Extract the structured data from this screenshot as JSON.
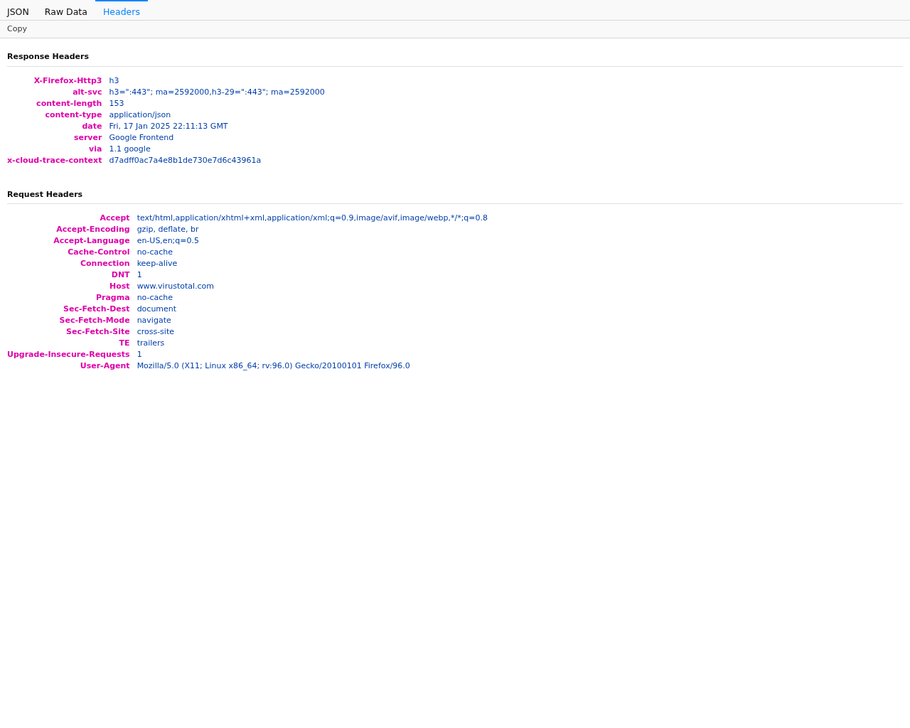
{
  "tabs": [
    {
      "label": "JSON",
      "selected": false
    },
    {
      "label": "Raw Data",
      "selected": false
    },
    {
      "label": "Headers",
      "selected": true
    }
  ],
  "toolbar": {
    "buttons": [
      "Copy"
    ]
  },
  "sections": [
    {
      "title": "Response Headers",
      "headers": [
        {
          "name": "X-Firefox-Http3",
          "value": "h3"
        },
        {
          "name": "alt-svc",
          "value": "h3=\":443\"; ma=2592000,h3-29=\":443\"; ma=2592000"
        },
        {
          "name": "content-length",
          "value": "153"
        },
        {
          "name": "content-type",
          "value": "application/json"
        },
        {
          "name": "date",
          "value": "Fri, 17 Jan 2025 22:11:13 GMT"
        },
        {
          "name": "server",
          "value": "Google Frontend"
        },
        {
          "name": "via",
          "value": "1.1 google"
        },
        {
          "name": "x-cloud-trace-context",
          "value": "d7adff0ac7a4e8b1de730e7d6c43961a"
        }
      ]
    },
    {
      "title": "Request Headers",
      "headers": [
        {
          "name": "Accept",
          "value": "text/html,application/xhtml+xml,application/xml;q=0.9,image/avif,image/webp,*/*;q=0.8"
        },
        {
          "name": "Accept-Encoding",
          "value": "gzip, deflate, br"
        },
        {
          "name": "Accept-Language",
          "value": "en-US,en;q=0.5"
        },
        {
          "name": "Cache-Control",
          "value": "no-cache"
        },
        {
          "name": "Connection",
          "value": "keep-alive"
        },
        {
          "name": "DNT",
          "value": "1"
        },
        {
          "name": "Host",
          "value": "www.virustotal.com"
        },
        {
          "name": "Pragma",
          "value": "no-cache"
        },
        {
          "name": "Sec-Fetch-Dest",
          "value": "document"
        },
        {
          "name": "Sec-Fetch-Mode",
          "value": "navigate"
        },
        {
          "name": "Sec-Fetch-Site",
          "value": "cross-site"
        },
        {
          "name": "TE",
          "value": "trailers"
        },
        {
          "name": "Upgrade-Insecure-Requests",
          "value": "1"
        },
        {
          "name": "User-Agent",
          "value": "Mozilla/5.0 (X11; Linux x86_64; rv:96.0) Gecko/20100101 Firefox/96.0"
        }
      ]
    }
  ]
}
